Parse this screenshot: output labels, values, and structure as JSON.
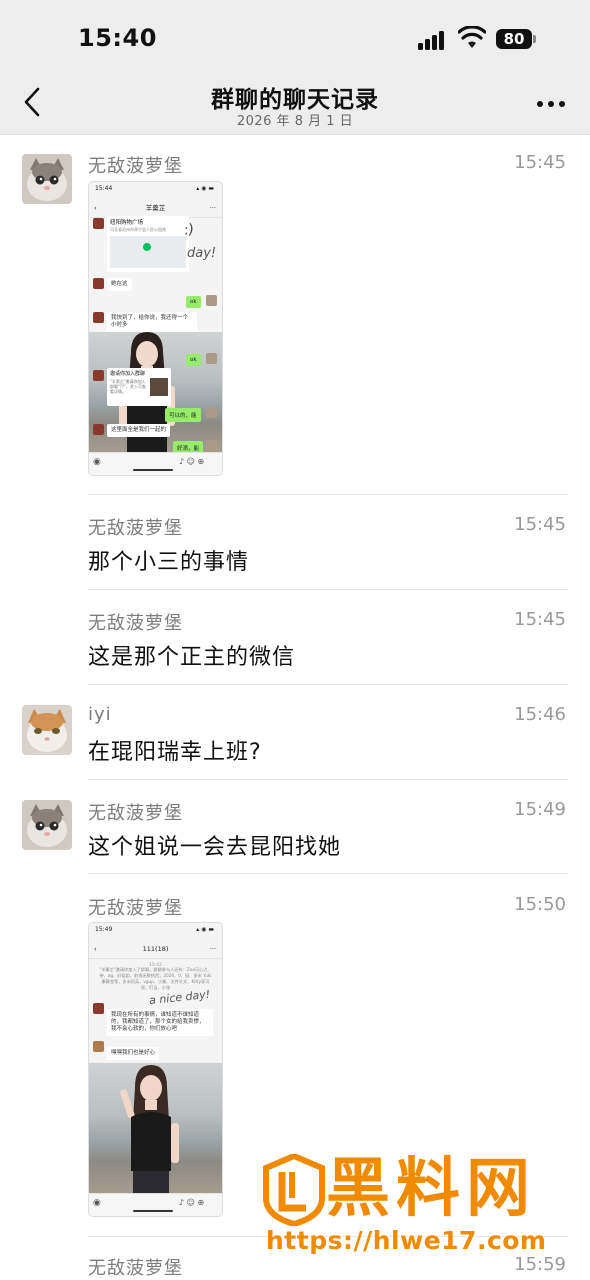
{
  "status_bar": {
    "time": "15:40",
    "battery": "80"
  },
  "nav": {
    "title": "群聊的聊天记录",
    "subtitle": "2026 年 8 月 1 日"
  },
  "messages": [
    {
      "sender": "无敌菠萝堡",
      "time": "15:45",
      "type": "image",
      "avatar": "kitten-gray"
    },
    {
      "sender": "无敌菠萝堡",
      "time": "15:45",
      "type": "text",
      "text": "那个小三的事情"
    },
    {
      "sender": "无敌菠萝堡",
      "time": "15:45",
      "type": "text",
      "text": "这是那个正主的微信"
    },
    {
      "sender": "iyi",
      "time": "15:46",
      "type": "text",
      "text": "在琨阳瑞幸上班?",
      "avatar": "kitten-orange"
    },
    {
      "sender": "无敌菠萝堡",
      "time": "15:49",
      "type": "text",
      "text": "这个姐说一会去昆阳找她",
      "avatar": "kitten-gray"
    },
    {
      "sender": "无敌菠萝堡",
      "time": "15:50",
      "type": "image"
    },
    {
      "sender": "无敌菠萝堡",
      "time": "15:59",
      "type": "text"
    }
  ],
  "thumb1": {
    "status_time": "15:44",
    "title": "羊羹芷",
    "loc_name": "纽阳购物广场",
    "loc_addr": "河北省沧州市肃宁县人民公园南",
    "msg_here": "她在这",
    "ok1": "ok",
    "msg_arrive": "我快到了，给你说，我还得一个小时多",
    "ok2": "ok",
    "invite_title": "邀请你加入群聊",
    "invite_body": "\"羊羹芷\"邀请你加入群聊\"??\"，进入可查看详情。",
    "green1": "可以的，能",
    "msg_all": "这里面全是我们一起的",
    "green2": "好滴，能"
  },
  "thumb2": {
    "status_time": "15:49",
    "title": "111(18)",
    "ts": "15:42",
    "sys": "\"羊羹芷\"邀请你加入了群聊，群聊参与人还有：Zoe可心之、带、ag、好姐姐，前排无数热烈，2026，0、挺、多米 Yuki 康静宜等，多米阿英，vgup、小美、文件头文、Kitty家可欣、叮当，小张",
    "msg1": "我现在所有的事情，谁知道不谁知道的，我都知道了，那个女的给我卖惨，我不会心软的，你们放心吧",
    "msg2": "嘿嘿我们也是好心"
  },
  "watermark": {
    "brand": "黑料网",
    "url": "https://hlwe17.com"
  },
  "colors": {
    "orange": "#f08a00",
    "wechat_green": "#95ec69",
    "bar_bg": "#ededed"
  }
}
